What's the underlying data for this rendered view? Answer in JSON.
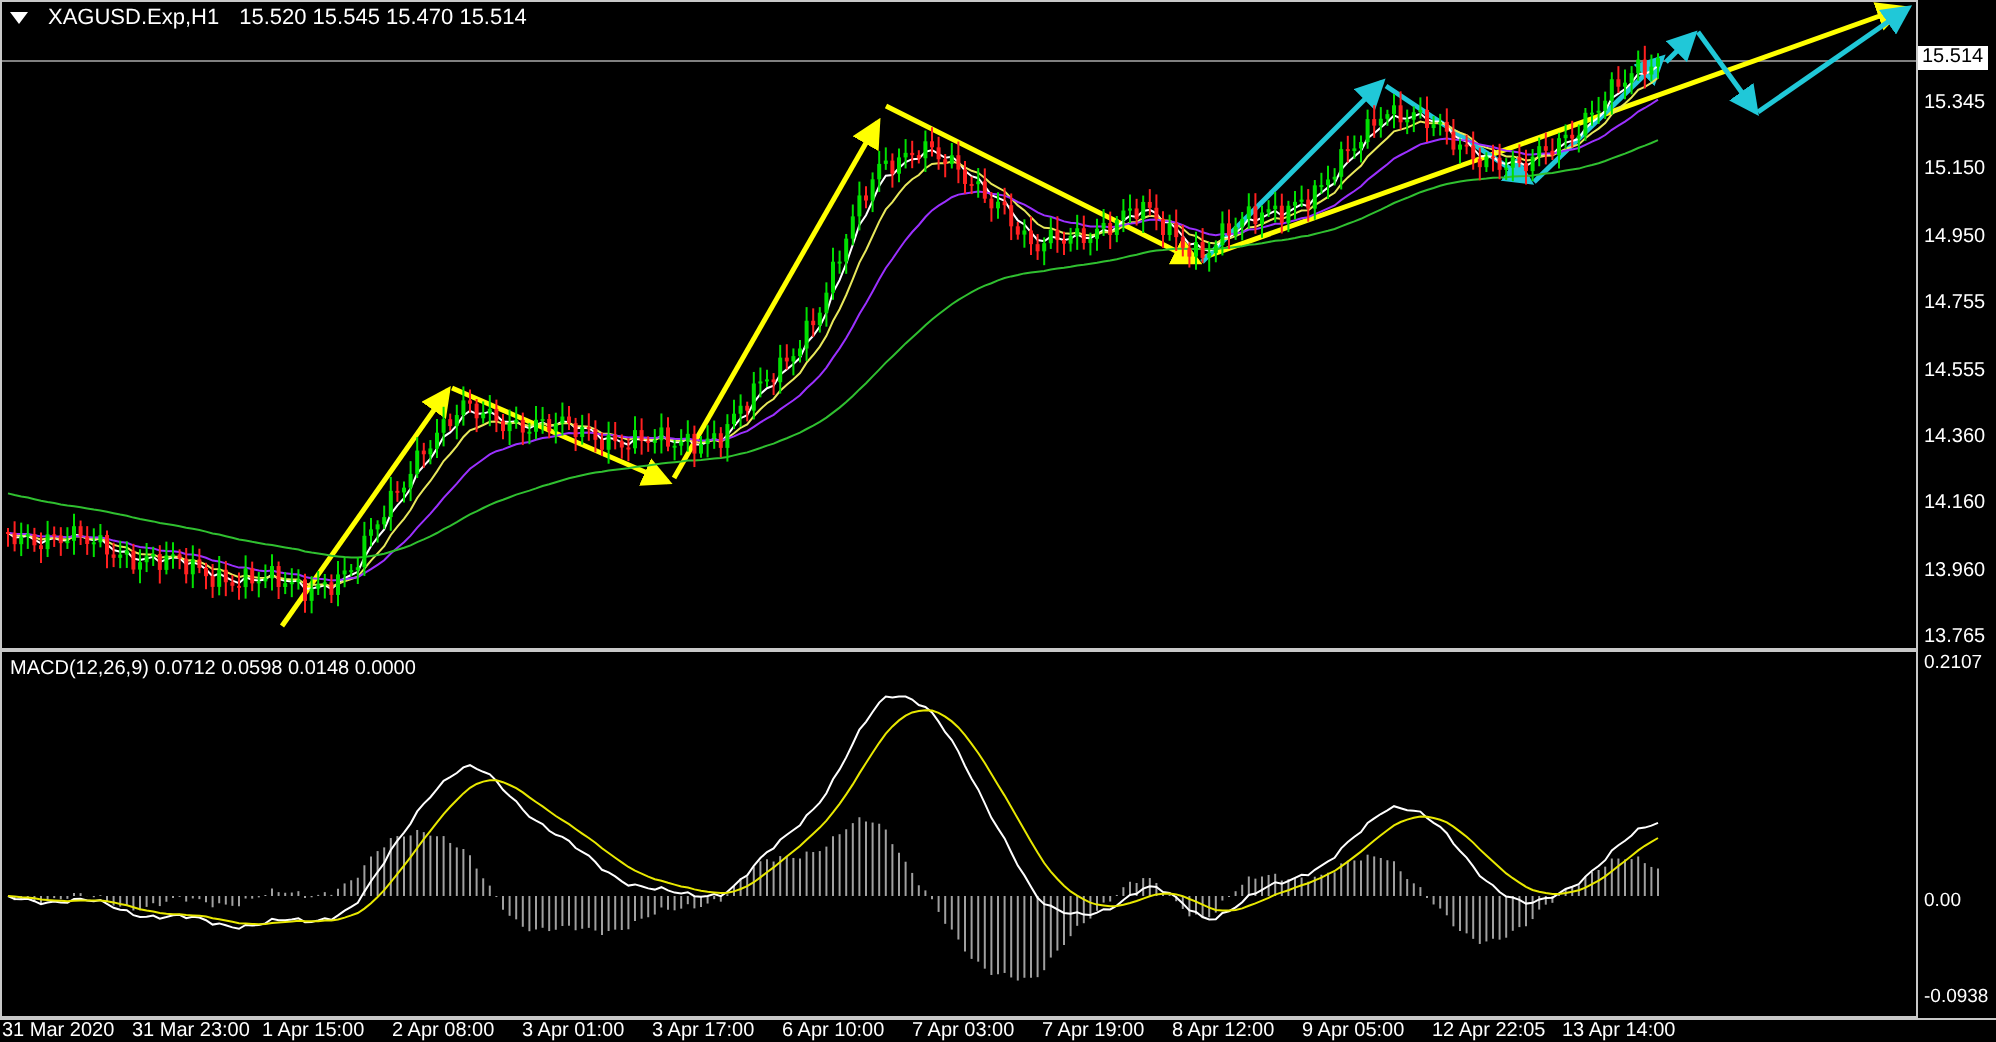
{
  "title": {
    "symbol": "XAGUSD.Exp,H1",
    "values": "15.520 15.545 15.470 15.514"
  },
  "price_axis": {
    "current_price": "15.514",
    "ticks": [
      "15.345",
      "15.150",
      "14.950",
      "14.755",
      "14.555",
      "14.360",
      "14.160",
      "13.960",
      "13.765"
    ]
  },
  "macd": {
    "label": "MACD(12,26,9) 0.0712 0.0598 0.0148 0.0000",
    "ticks": [
      "0.2107",
      "0.00",
      "-0.0938"
    ]
  },
  "time_axis": [
    "31 Mar 2020",
    "31 Mar 23:00",
    "1 Apr 15:00",
    "2 Apr 08:00",
    "3 Apr 01:00",
    "3 Apr 17:00",
    "6 Apr 10:00",
    "7 Apr 03:00",
    "7 Apr 19:00",
    "8 Apr 12:00",
    "9 Apr 05:00",
    "12 Apr 22:05",
    "13 Apr 14:00"
  ]
}
